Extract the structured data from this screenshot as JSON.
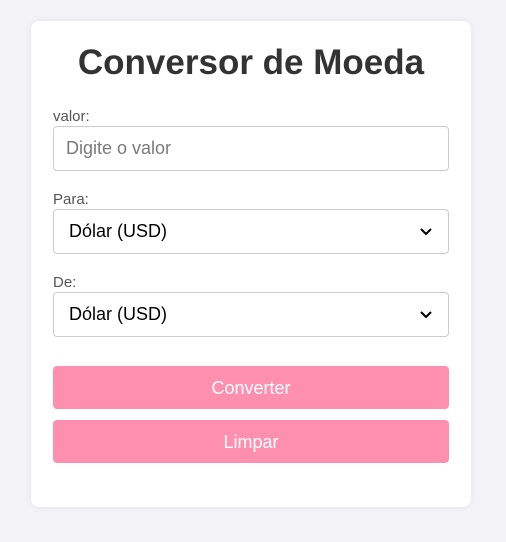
{
  "title": "Conversor de Moeda",
  "valor": {
    "label": "valor:",
    "placeholder": "Digite o valor",
    "value": ""
  },
  "para": {
    "label": "Para:",
    "selected": "Dólar (USD)"
  },
  "de": {
    "label": "De:",
    "selected": "Dólar (USD)"
  },
  "buttons": {
    "convert_label": "Converter",
    "clear_label": "Limpar"
  },
  "colors": {
    "button_bg": "#ff8faf",
    "page_bg": "#f4f4f8",
    "card_bg": "#ffffff",
    "title": "#333333"
  },
  "icons": {
    "select_arrow": "chevron-down-icon"
  }
}
